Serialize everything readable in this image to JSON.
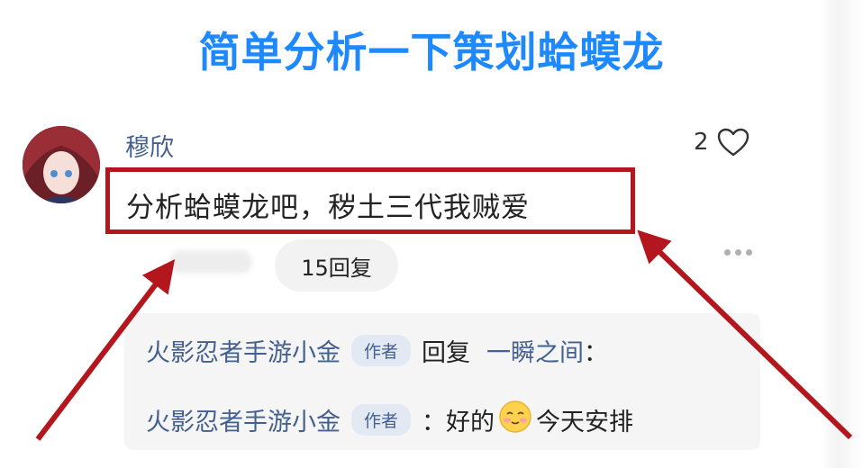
{
  "banner": {
    "title": "简单分析一下策划蛤蟆龙"
  },
  "comment": {
    "username": "穆欣",
    "like_count": "2",
    "text": "分析蛤蟆龙吧，秽土三代我贼爱",
    "reply_button": "15回复"
  },
  "replies": [
    {
      "name": "火影忍者手游小金",
      "badge": "作者",
      "verb": "回复",
      "target": "一瞬之间",
      "colon": "："
    },
    {
      "name": "火影忍者手游小金",
      "badge": "作者",
      "colon": "：",
      "text_before": "好的",
      "emoji": "smiling-face-emoji",
      "text_after": "今天安排"
    }
  ],
  "colors": {
    "banner": "#1e88ff",
    "highlight": "#b3171d",
    "link": "#44608e",
    "reply_bg": "#f5f5f5"
  },
  "icons": [
    "heart-outline-icon",
    "more-dots-icon",
    "smiling-face-emoji",
    "red-arrow"
  ]
}
